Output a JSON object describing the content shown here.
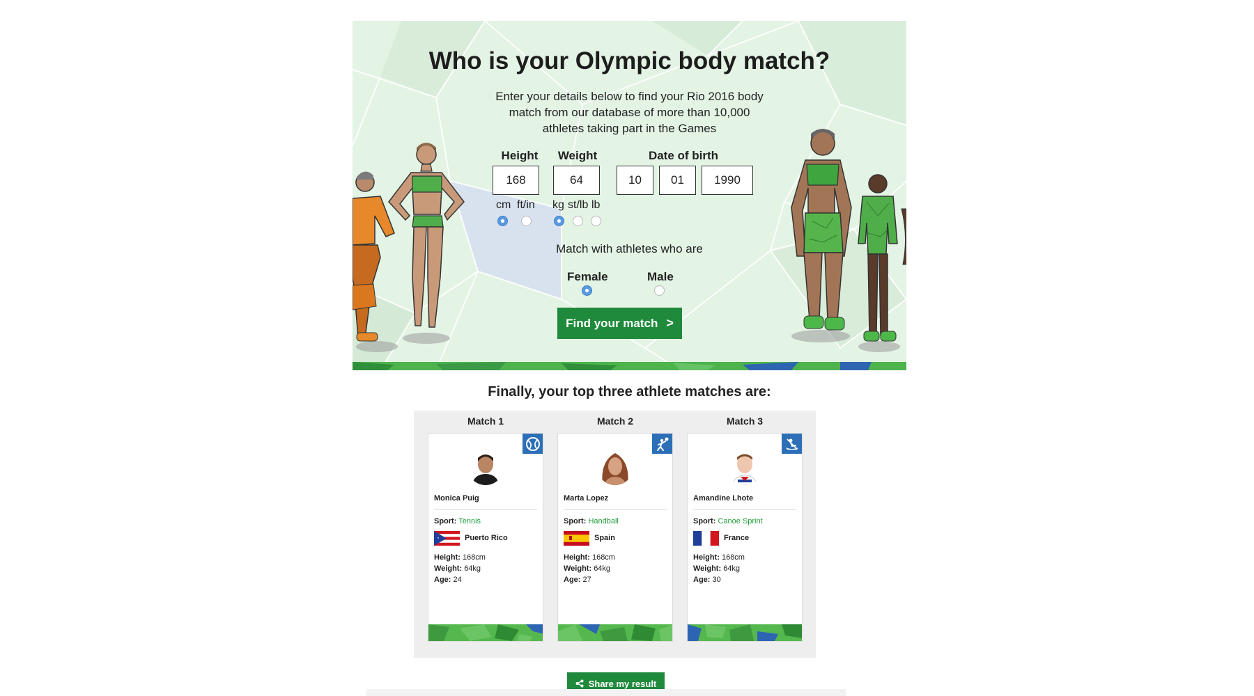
{
  "hero": {
    "title": "Who is your Olympic body match?",
    "intro_lines": [
      "Enter your details below to find your Rio 2016 body",
      "match from our database of more than 10,000",
      "athletes taking part in the Games"
    ],
    "fields": {
      "height": {
        "label": "Height",
        "value": "168",
        "units": [
          "cm",
          "ft/in"
        ],
        "selected_unit": "cm"
      },
      "weight": {
        "label": "Weight",
        "value": "64",
        "units": [
          "kg",
          "st/lb",
          "lb"
        ],
        "selected_unit": "kg"
      },
      "dob": {
        "label": "Date of birth",
        "day": "10",
        "month": "01",
        "year": "1990"
      }
    },
    "match_with_label": "Match with athletes who are",
    "gender_options": [
      "Female",
      "Male"
    ],
    "selected_gender": "Female",
    "find_button_label": "Find your match",
    "find_button_chevron": ">"
  },
  "results": {
    "title": "Finally, your top three athlete matches are:",
    "matches": [
      {
        "label": "Match 1",
        "name": "Monica Puig",
        "sport_label": "Sport:",
        "sport": "Tennis",
        "sport_icon": "tennis-icon",
        "country": "Puerto Rico",
        "flag": "puerto-rico-flag",
        "height_label": "Height:",
        "height": "168cm",
        "weight_label": "Weight:",
        "weight": "64kg",
        "age_label": "Age:",
        "age": "24"
      },
      {
        "label": "Match 2",
        "name": "Marta Lopez",
        "sport_label": "Sport:",
        "sport": "Handball",
        "sport_icon": "handball-icon",
        "country": "Spain",
        "flag": "spain-flag",
        "height_label": "Height:",
        "height": "168cm",
        "weight_label": "Weight:",
        "weight": "64kg",
        "age_label": "Age:",
        "age": "27"
      },
      {
        "label": "Match 3",
        "name": "Amandine Lhote",
        "sport_label": "Sport:",
        "sport": "Canoe Sprint",
        "sport_icon": "canoe-sprint-icon",
        "country": "France",
        "flag": "france-flag",
        "height_label": "Height:",
        "height": "168cm",
        "weight_label": "Weight:",
        "weight": "64kg",
        "age_label": "Age:",
        "age": "30"
      }
    ],
    "share_button_label": "Share my result",
    "share_icon": "share-icon"
  },
  "colors": {
    "hero_background": "#e3f3e4",
    "primary_green": "#1f8a3b",
    "sport_green": "#1f9a3a",
    "sport_icon_blue": "#2c6fb7",
    "radio_selected": "#5a9be0"
  }
}
